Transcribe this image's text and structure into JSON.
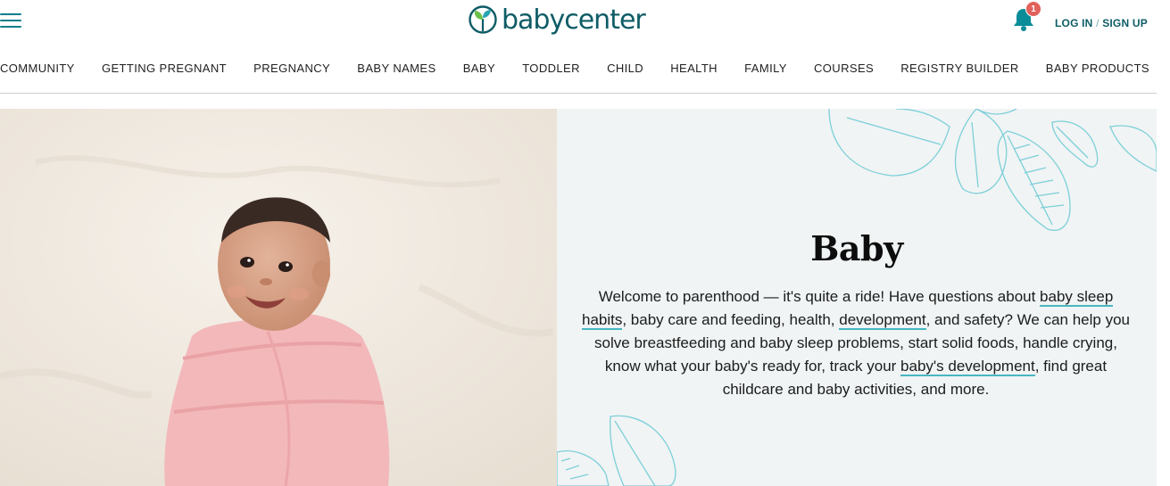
{
  "header": {
    "logo_text": "babycenter",
    "notification_count": "1",
    "login_label": "LOG IN",
    "separator": "/",
    "signup_label": "SIGN UP"
  },
  "nav": {
    "items": [
      "COMMUNITY",
      "GETTING PREGNANT",
      "PREGNANCY",
      "BABY NAMES",
      "BABY",
      "TODDLER",
      "CHILD",
      "HEALTH",
      "FAMILY",
      "COURSES",
      "REGISTRY BUILDER",
      "BABY PRODUCTS"
    ]
  },
  "hero": {
    "title": "Baby",
    "text_1": "Welcome to parenthood — it's quite a ride! Have questions about ",
    "link_1": "baby sleep habits",
    "text_2": ", baby care and feeding, health, ",
    "link_2": "development",
    "text_3": ", and safety? We can help you solve breastfeeding and baby sleep problems, start solid foods, handle crying, know what your baby's ready for, track your ",
    "link_3": "baby's development",
    "text_4": ", find great childcare and baby activities, and more."
  },
  "colors": {
    "brand_teal": "#0e5c66",
    "accent_teal": "#47b7c2",
    "badge_red": "#e2615a",
    "panel_bg": "#f0f4f4",
    "swaddle_pink": "#f3b8ba"
  }
}
